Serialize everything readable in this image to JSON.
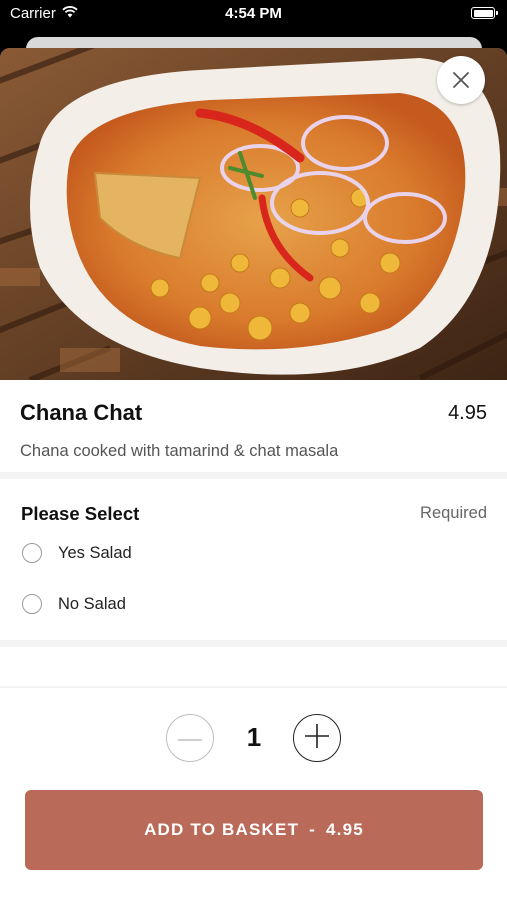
{
  "status_bar": {
    "carrier": "Carrier",
    "time": "4:54 PM"
  },
  "item": {
    "name": "Chana Chat",
    "price": "4.95",
    "description": "Chana cooked with tamarind & chat masala"
  },
  "options_section": {
    "title": "Please Select",
    "required_label": "Required",
    "options": [
      {
        "label": "Yes Salad",
        "selected": false
      },
      {
        "label": "No Salad",
        "selected": false
      }
    ]
  },
  "quantity": {
    "value": "1"
  },
  "add_button": {
    "label": "ADD TO BASKET",
    "separator": "-",
    "price": "4.95"
  },
  "colors": {
    "accent": "#b96a58",
    "background": "#ffffff",
    "divider": "#f4f4f4"
  },
  "icons": [
    "wifi-icon",
    "battery-icon",
    "close-icon",
    "minus-icon",
    "plus-icon"
  ]
}
